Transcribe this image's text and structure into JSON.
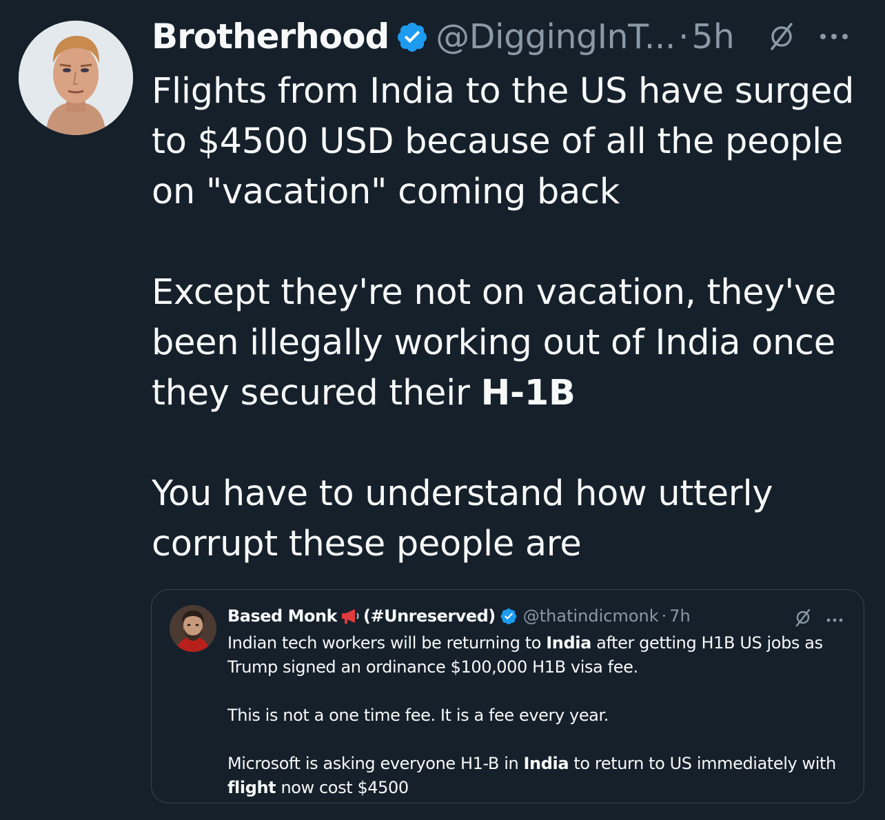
{
  "tweet": {
    "display_name": "Brotherhood",
    "handle": "@DiggingInT...",
    "separator": "·",
    "time": "5h",
    "body": {
      "para1": "Flights from India to the US have surged to $4500 USD because of all the people on \"vacation\" coming back",
      "para2_lead": "Except they're not on vacation, they've been illegally working out of India once they secured their ",
      "para2_bold": "H-1B",
      "para3": "You have to understand how utterly corrupt these people are"
    }
  },
  "quote": {
    "display_name_a": "Based Monk",
    "display_name_b": "(#Unreserved)",
    "handle": "@thatindicmonk",
    "separator": "·",
    "time": "7h",
    "body": {
      "p1_a": "Indian tech workers will be returning to ",
      "p1_bold": "India",
      "p1_b": " after getting H1B US jobs as Trump signed an ordinance $100,000 H1B visa fee.",
      "p2": "This is not a one time fee. It is a fee every year.",
      "p3_a": "Microsoft is asking everyone H1-B in ",
      "p3_bold1": "India",
      "p3_b": " to return to US immediately with ",
      "p3_bold2": "flight",
      "p3_c": " now cost $4500"
    }
  },
  "icons": {
    "verified": "verified-badge-icon",
    "grok": "grok-icon",
    "more": "more-icon",
    "megaphone": "megaphone-icon"
  },
  "colors": {
    "background": "#15202b",
    "text": "#f7f9f9",
    "muted": "#8b98a5",
    "verified": "#1d9bf0",
    "border": "#38444d"
  }
}
